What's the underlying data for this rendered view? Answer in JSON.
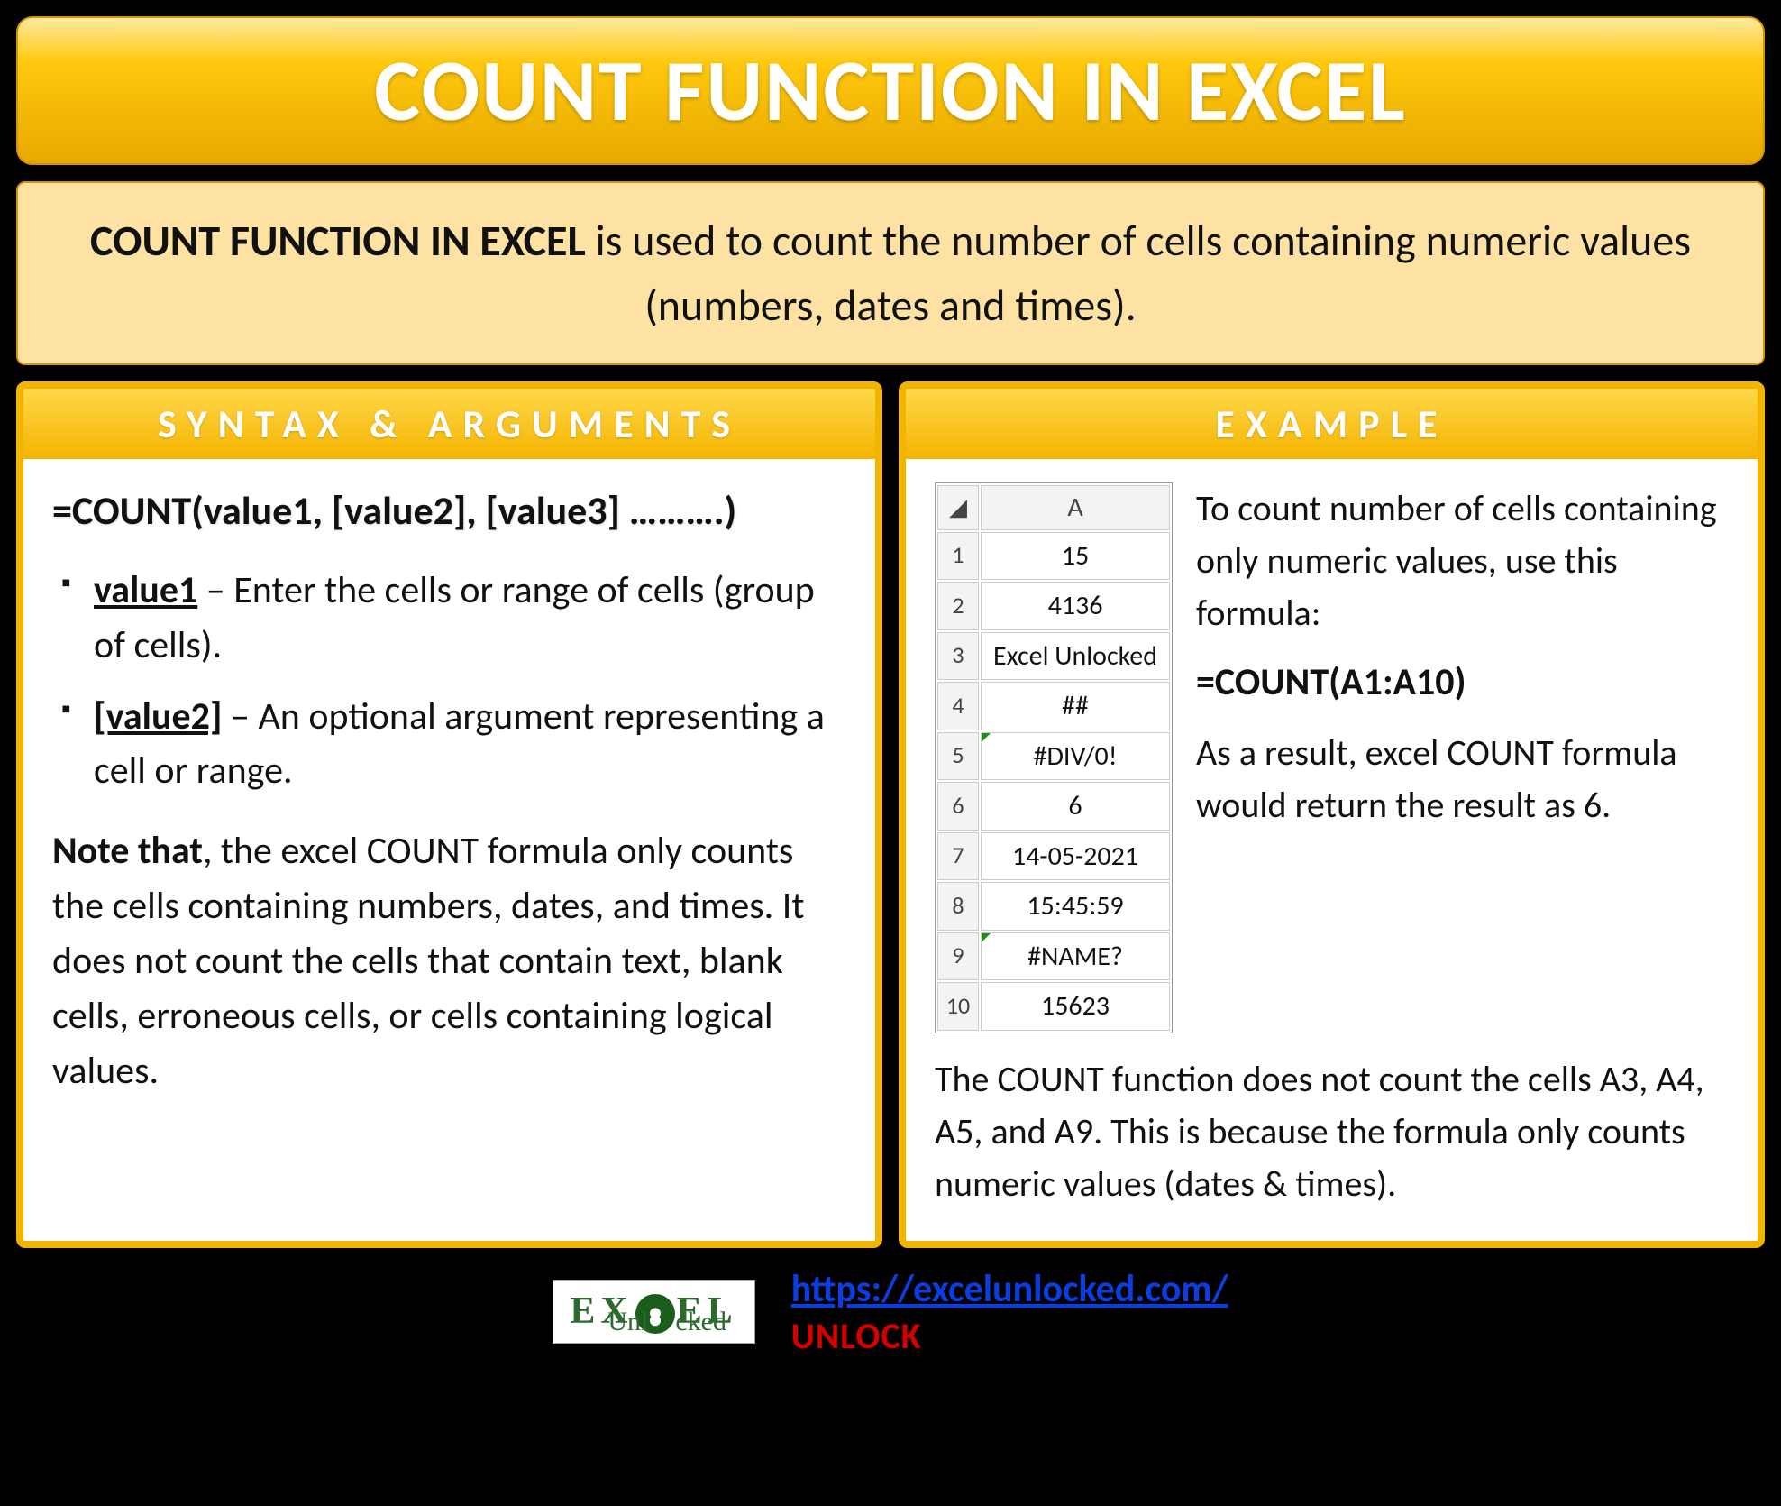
{
  "title": "COUNT FUNCTION IN EXCEL",
  "intro": {
    "bold": "COUNT FUNCTION IN EXCEL",
    "rest": " is used to count the number of cells containing numeric values (numbers, dates and times)."
  },
  "syntax_panel": {
    "header": "SYNTAX & ARGUMENTS",
    "syntax": "=COUNT(value1, [value2], [value3] ……….)",
    "args": [
      {
        "name": "value1",
        "desc": " – Enter the cells or range of cells (group of cells)."
      },
      {
        "name": "[value2]",
        "desc": " – An optional argument representing a cell or range."
      }
    ],
    "note_bold": "Note that",
    "note_rest": ", the excel COUNT formula only counts the cells containing numbers, dates, and times. It does not count the cells that contain text, blank cells, erroneous cells, or cells containing logical values."
  },
  "example_panel": {
    "header": "EXAMPLE",
    "sheet": {
      "col": "A",
      "rows": [
        {
          "n": "1",
          "v": "15",
          "err": false
        },
        {
          "n": "2",
          "v": "4136",
          "err": false
        },
        {
          "n": "3",
          "v": "Excel Unlocked",
          "err": false
        },
        {
          "n": "4",
          "v": "##",
          "err": false
        },
        {
          "n": "5",
          "v": "#DIV/0!",
          "err": true
        },
        {
          "n": "6",
          "v": "6",
          "err": false
        },
        {
          "n": "7",
          "v": "14-05-2021",
          "err": false
        },
        {
          "n": "8",
          "v": "15:45:59",
          "err": false
        },
        {
          "n": "9",
          "v": "#NAME?",
          "err": true
        },
        {
          "n": "10",
          "v": "15623",
          "err": false
        }
      ]
    },
    "text1": "To count number of cells containing only numeric values, use this formula:",
    "formula": "=COUNT(A1:A10)",
    "text2": "As a result, excel COUNT formula would return the result as 6.",
    "footnote": "The COUNT function does not count the cells A3, A4, A5, and A9. This is because the formula only counts numeric values (dates & times)."
  },
  "footer": {
    "logo_top": "EX   EL",
    "logo_sub": "Unl   cked",
    "url": "https://excelunlocked.com/",
    "unlock": "UNLOCK"
  }
}
